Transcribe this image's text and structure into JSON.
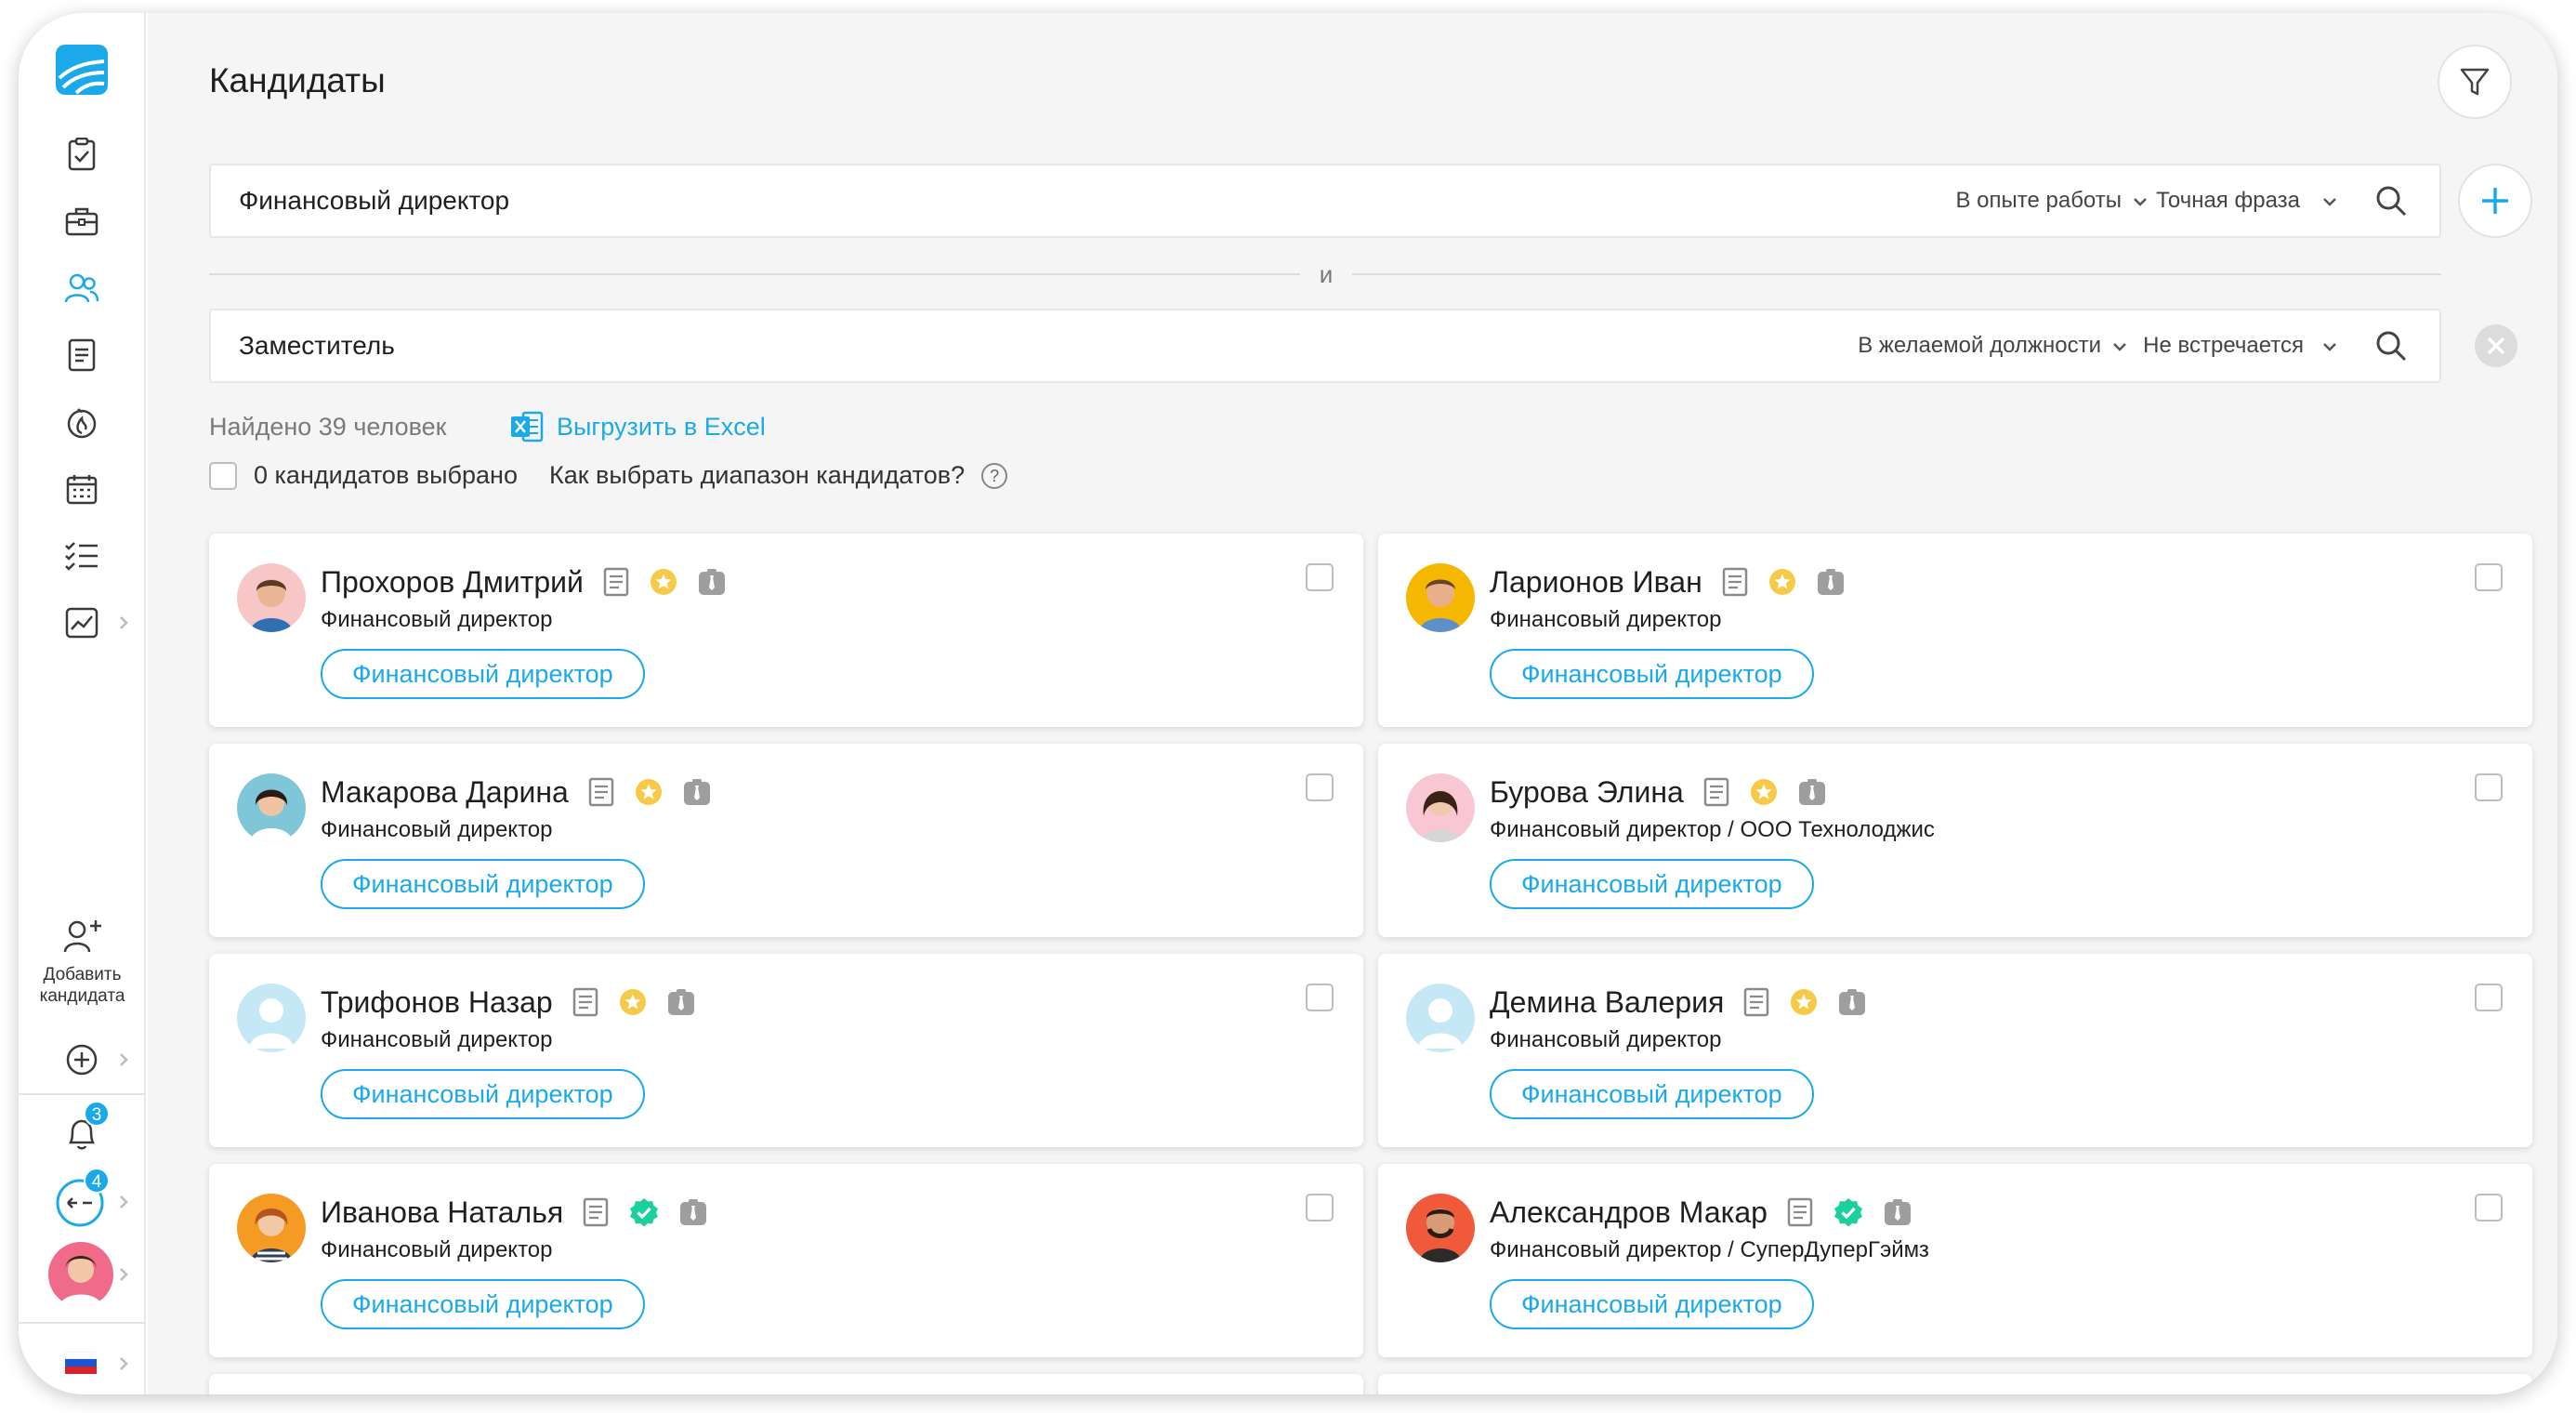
{
  "header": {
    "title": "Кандидаты"
  },
  "search": [
    {
      "value": "Финансовый директор",
      "scope": "В опыте работы",
      "mode": "Точная фраза"
    },
    {
      "value": "Заместитель",
      "scope": "В желаемой должности",
      "mode": "Не встречается"
    }
  ],
  "and_label": "и",
  "results": {
    "found": "Найдено 39 человек",
    "export": "Выгрузить в Excel",
    "selected": "0 кандидатов выбрано",
    "range_help": "Как выбрать диапазон кандидатов?"
  },
  "sidebar": {
    "add_candidate_line1": "Добавить",
    "add_candidate_line2": "кандидата",
    "notifications_count": "3",
    "tasks_count": "4"
  },
  "colors": {
    "accent": "#1ba9ea",
    "star": "#f7c948",
    "verified": "#1ccf9e",
    "icon_gray": "#9e9e9e"
  },
  "candidates": [
    {
      "name": "Прохоров Дмитрий",
      "subtitle": "Финансовый директор",
      "tag": "Финансовый директор",
      "status_icon": "star-badge-icon",
      "avatar": "man-brown-hair"
    },
    {
      "name": "Ларионов  Иван",
      "subtitle": "Финансовый директор",
      "tag": "Финансовый директор",
      "status_icon": "star-badge-icon",
      "avatar": "man-yellow-bg"
    },
    {
      "name": "Макарова Дарина",
      "subtitle": "Финансовый директор",
      "tag": "Финансовый директор",
      "status_icon": "star-badge-icon",
      "avatar": "woman-blue-bg"
    },
    {
      "name": "Бурова Элина",
      "subtitle": "Финансовый директор / ООО Технолоджис",
      "tag": "Финансовый директор",
      "status_icon": "star-badge-icon",
      "avatar": "woman-pink-bg"
    },
    {
      "name": "Трифонов Назар",
      "subtitle": "Финансовый директор",
      "tag": "Финансовый директор",
      "status_icon": "star-badge-icon",
      "avatar": "placeholder-person"
    },
    {
      "name": "Демина Валерия",
      "subtitle": "Финансовый директор",
      "tag": "Финансовый директор",
      "status_icon": "star-badge-icon",
      "avatar": "placeholder-person"
    },
    {
      "name": "Иванова Наталья",
      "subtitle": "Финансовый директор",
      "tag": "Финансовый директор",
      "status_icon": "verified-badge-icon",
      "avatar": "woman-orange-bg"
    },
    {
      "name": "Александров Макар",
      "subtitle": "Финансовый директор / СуперДуперГэймз",
      "tag": "Финансовый директор",
      "status_icon": "verified-badge-icon",
      "avatar": "man-red-bg"
    }
  ]
}
